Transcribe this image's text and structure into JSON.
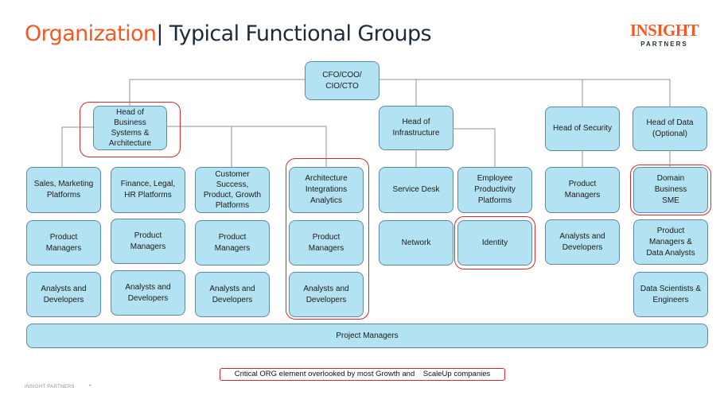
{
  "title": {
    "accent": "Organization",
    "rest": "| Typical Functional Groups"
  },
  "logo": {
    "line1": "INSIGHT",
    "line2": "PARTNERS"
  },
  "colors": {
    "accent": "#f15a24",
    "box_fill": "#b3e3f2",
    "box_border": "#5f87a8",
    "highlight": "#d02c2c"
  },
  "root": {
    "label": "CFO/COO/\nCIO/CTO"
  },
  "departments": [
    {
      "head": "Head of\nBusiness\nSystems &\nArchitecture",
      "highlighted": true,
      "columns": [
        {
          "items": [
            "Sales, Marketing\nPlatforms",
            "Product\nManagers",
            "Analysts and\nDevelopers"
          ],
          "highlighted": false
        },
        {
          "items": [
            "Finance, Legal,\nHR Platforms",
            "Product\nManagers",
            "Analysts and\nDevelopers"
          ],
          "highlighted": false
        },
        {
          "items": [
            "Customer\nSuccess,\nProduct, Growth\nPlatforms",
            "Product\nManagers",
            "Analysts and\nDevelopers"
          ],
          "highlighted": false
        },
        {
          "items": [
            "Architecture\nIntegrations\nAnalytics",
            "Product\nManagers",
            "Analysts and\nDevelopers"
          ],
          "highlighted": true
        }
      ]
    },
    {
      "head": "Head of\nInfrastructure",
      "highlighted": false,
      "columns": [
        {
          "items": [
            "Service Desk",
            "Network"
          ],
          "highlighted": false
        },
        {
          "items": [
            "Employee\nProductivity\nPlatforms",
            "Identity"
          ],
          "highlighted_items": [
            1
          ]
        }
      ]
    },
    {
      "head": "Head of Security",
      "highlighted": false,
      "columns": [
        {
          "items": [
            "Product\nManagers",
            "Analysts and\nDevelopers"
          ],
          "highlighted": false
        }
      ]
    },
    {
      "head": "Head of Data\n(Optional)",
      "highlighted": false,
      "columns": [
        {
          "items": [
            "Domain\nBusiness\nSME",
            "Product\nManagers &\nData Analysts",
            "Data Scientists &\nEngineers"
          ],
          "highlighted_items": [
            0
          ]
        }
      ]
    }
  ],
  "project_managers": {
    "label": "Project Managers"
  },
  "legend": {
    "text": "Critical ORG element overlooked by most Growth and    ScaleUp companies"
  },
  "footer": {
    "brand": "INSIGHT PARTNERS",
    "dot": "•"
  }
}
